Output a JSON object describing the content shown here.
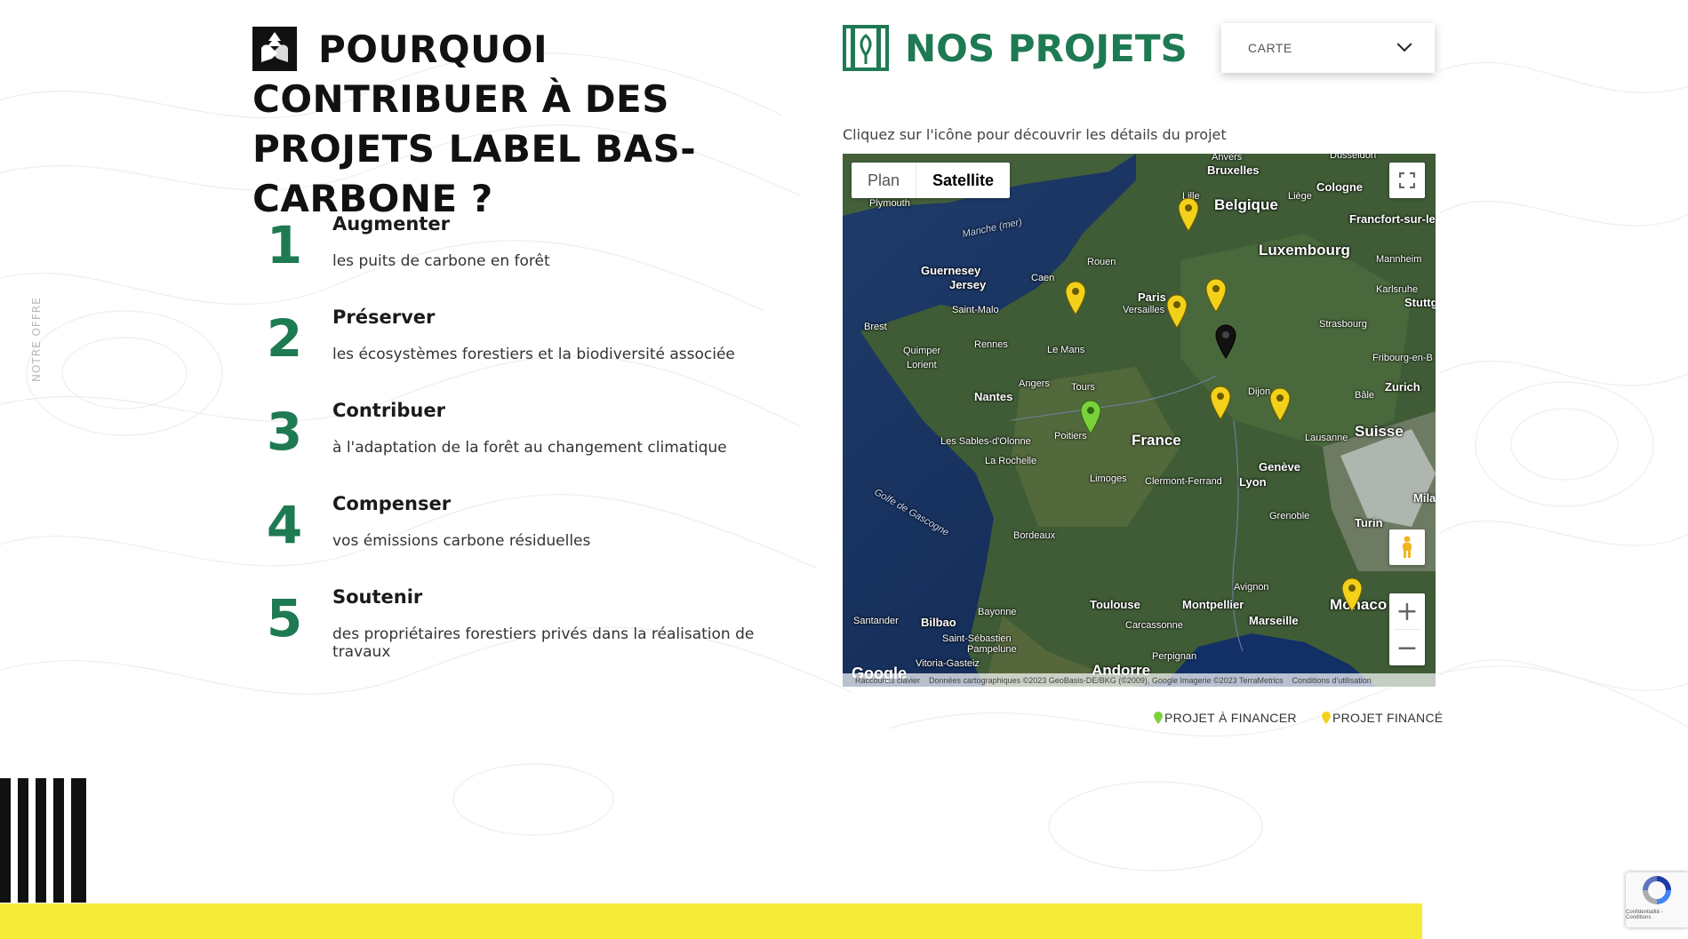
{
  "side_label": "NOTRE OFFRE",
  "why": {
    "title": "POURQUOI CONTRIBUER À DES PROJETS LABEL BAS-CARBONE ?",
    "items": [
      {
        "num": "1",
        "title": "Augmenter",
        "desc": "les puits de carbone en forêt"
      },
      {
        "num": "2",
        "title": "Préserver",
        "desc": "les écosystèmes forestiers et la biodiversité associée"
      },
      {
        "num": "3",
        "title": "Contribuer",
        "desc": "à l'adaptation de la forêt au changement climatique"
      },
      {
        "num": "4",
        "title": "Compenser",
        "desc": "vos émissions carbone résiduelles"
      },
      {
        "num": "5",
        "title": "Soutenir",
        "desc": "des propriétaires forestiers privés dans la réalisation de travaux"
      }
    ]
  },
  "projects": {
    "title": "NOS PROJETS",
    "view_select": "CARTE",
    "hint": "Cliquez sur l'icône pour découvrir les détails du projet"
  },
  "map": {
    "type_plan": "Plan",
    "type_satellite": "Satellite",
    "labels": {
      "anvers": "Anvers",
      "dusseldorf": "Dusseldorf",
      "bruxelles": "Bruxelles",
      "cologne": "Cologne",
      "lille": "Lille",
      "liege": "Liège",
      "belgique": "Belgique",
      "plymouth": "Plymouth",
      "francfort": "Francfort-sur-le",
      "manche": "Manche (mer)",
      "luxembourg": "Luxembourg",
      "mannheim": "Mannheim",
      "guernesey": "Guernesey",
      "jersey": "Jersey",
      "rouen": "Rouen",
      "caen": "Caen",
      "paris": "Paris",
      "versailles": "Versailles",
      "karlsruhe": "Karlsruhe",
      "stuttg": "Stuttg",
      "saint_malo": "Saint-Malo",
      "brest": "Brest",
      "strasbourg": "Strasbourg",
      "rennes": "Rennes",
      "quimper": "Quimper",
      "le_mans": "Le Mans",
      "fribourg": "Fribourg-en-B",
      "lorient": "Lorient",
      "angers": "Angers",
      "tours": "Tours",
      "dijon": "Dijon",
      "zurich": "Zurich",
      "bale": "Bâle",
      "nantes": "Nantes",
      "poitiers": "Poitiers",
      "france": "France",
      "lausanne": "Lausanne",
      "suisse": "Suisse",
      "sables": "Les Sables-d'Olonne",
      "la_rochelle": "La Rochelle",
      "geneve": "Genève",
      "limoges": "Limoges",
      "clermont": "Clermont-Ferrand",
      "lyon": "Lyon",
      "golfe": "Golfe de Gascogne",
      "mila": "Mila",
      "grenoble": "Grenoble",
      "turin": "Turin",
      "bordeaux": "Bordeaux",
      "avignon": "Avignon",
      "toulouse": "Toulouse",
      "montpellier": "Montpellier",
      "monaco": "Monaco",
      "bayonne": "Bayonne",
      "marseille": "Marseille",
      "santander": "Santander",
      "bilbao": "Bilbao",
      "carcassonne": "Carcassonne",
      "saint_sebastien": "Saint-Sébastien",
      "pampelune": "Pampelune",
      "perpignan": "Perpignan",
      "vitoria": "Vitoria-Gasteiz",
      "andorre": "Andorre",
      "google": "Google"
    },
    "attribution": {
      "shortcuts": "Raccourcis clavier",
      "data": "Données cartographiques ©2023 GeoBasis-DE/BKG (©2009), Google Imagerie ©2023 TerraMetrics",
      "terms": "Conditions d'utilisation"
    },
    "pin_colors": {
      "yellow": "#f3d11b",
      "green": "#7bd13c",
      "black": "#111111"
    }
  },
  "legend": {
    "to_finance": "PROJET À FINANCER",
    "financed": "PROJET FINANCÉ"
  },
  "recaptcha": {
    "text": "Confidentialité - Conditions"
  },
  "colors": {
    "accent_green": "#1e7a52",
    "band_yellow": "#f5ec3a"
  }
}
